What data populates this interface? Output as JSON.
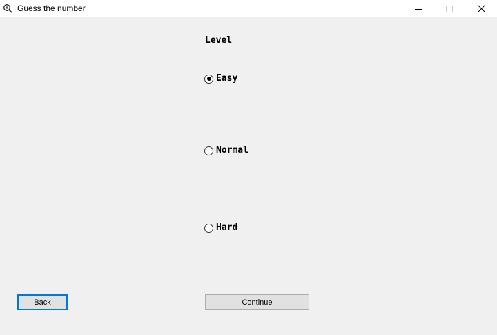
{
  "window": {
    "title": "Guess the number",
    "app_icon": "magnifier-icon",
    "controls": [
      "minimize-icon",
      "maximize-icon",
      "close-icon"
    ]
  },
  "form": {
    "level_label": "Level",
    "options": [
      {
        "label": "Easy",
        "checked": true
      },
      {
        "label": "Normal",
        "checked": false
      },
      {
        "label": "Hard",
        "checked": false
      }
    ],
    "back_label": "Back",
    "continue_label": "Continue"
  },
  "colors": {
    "background": "#f0f0f0",
    "focus_border": "#0078d7"
  }
}
